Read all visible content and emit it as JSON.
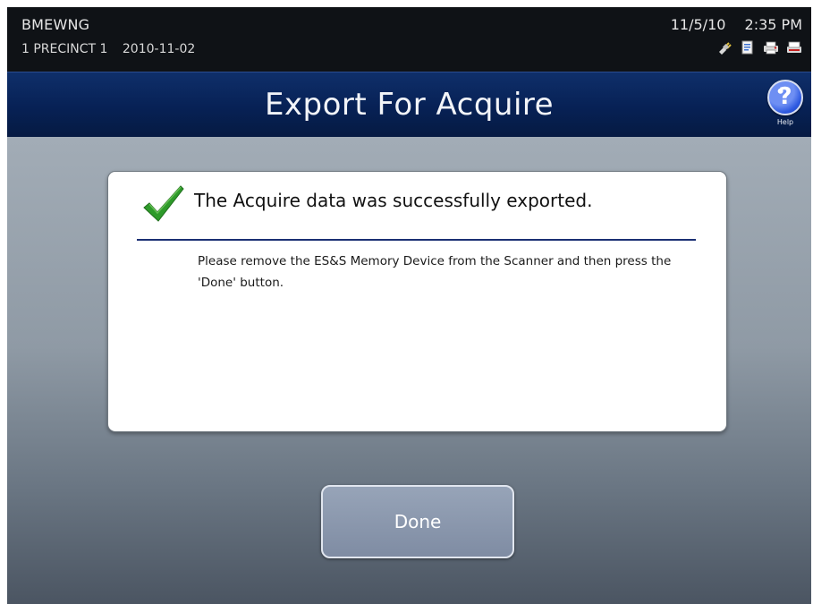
{
  "status": {
    "name": "BMEWNG",
    "precinct": "1 PRECINCT 1",
    "date_code": "2010-11-02",
    "date": "11/5/10",
    "time": "2:35 PM",
    "icons": [
      "plug-icon",
      "document-icon",
      "printer-icon",
      "scanner-icon"
    ]
  },
  "header": {
    "title": "Export For Acquire",
    "help_label": "Help",
    "help_symbol": "?"
  },
  "message": {
    "title": "The Acquire data was successfully exported.",
    "body": "Please remove the ES&S Memory Device from the Scanner and then press the 'Done' button.",
    "check_color": "#2e9a2a"
  },
  "actions": {
    "done_label": "Done"
  }
}
